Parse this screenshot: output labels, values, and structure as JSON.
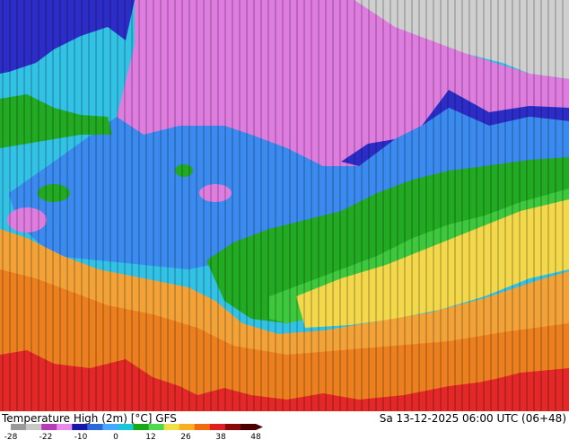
{
  "footer": {
    "title": "Temperature High (2m) [°C] GFS",
    "datetime": "Sa 13-12-2025 06:00 UTC (06+48)"
  },
  "legend": {
    "ticks": [
      "-28",
      "-22",
      "-10",
      "0",
      "12",
      "26",
      "38",
      "48"
    ],
    "colors": [
      "#9a9a9a",
      "#c8c8c8",
      "#b63cb6",
      "#e88ae8",
      "#1818a8",
      "#2a6ad8",
      "#48a8ff",
      "#18c8d8",
      "#18a818",
      "#50d850",
      "#f0e048",
      "#f8b020",
      "#f06a10",
      "#e02020",
      "#8a0a0a",
      "#4a0000"
    ]
  },
  "map": {
    "region_colors": {
      "gray": "#cfcfcf",
      "magenta": "#df7cdf",
      "navy": "#2c2cc8",
      "blue": "#3a8af0",
      "cyan": "#32c2e6",
      "green": "#22aa22",
      "lightgreen": "#3ec83e",
      "yellow": "#f2d84a",
      "orange": "#f3a238",
      "darkorange": "#ec8020",
      "red": "#e42828"
    }
  }
}
